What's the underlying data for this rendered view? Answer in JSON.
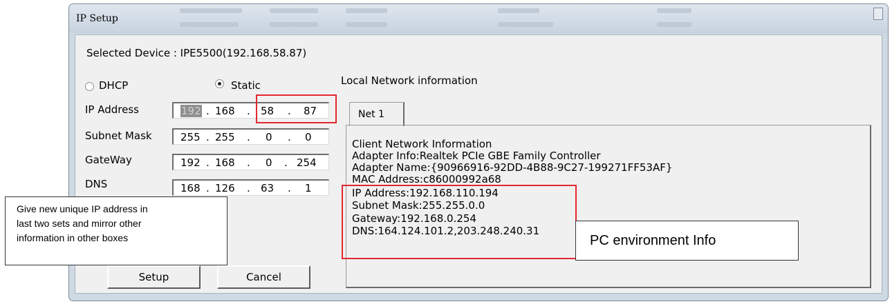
{
  "window": {
    "title": "IP Setup"
  },
  "selected_device": "Selected Device : IPE5500(192.168.58.87)",
  "mode": {
    "dhcp_label": "DHCP",
    "static_label": "Static",
    "selected": "Static"
  },
  "fields": {
    "ip_label": "IP Address",
    "subnet_label": "Subnet Mask",
    "gateway_label": "GateWay",
    "dns_label": "DNS",
    "ip": [
      "192",
      "168",
      "58",
      "87"
    ],
    "subnet": [
      "255",
      "255",
      "0",
      "0"
    ],
    "gateway": [
      "192",
      "168",
      "0",
      "254"
    ],
    "dns": [
      "168",
      "126",
      "63",
      "1"
    ]
  },
  "buttons": {
    "setup": "Setup",
    "cancel": "Cancel"
  },
  "local_network": {
    "heading": "Local Network information",
    "tab": "Net 1",
    "lines": [
      "Client Network Information",
      "Adapter Info:Realtek PCIe GBE Family Controller",
      "Adapter Name:{90966916-92DD-4B88-9C27-199271FF53AF}",
      "MAC Address:c86000992a68",
      "IP Address:192.168.110.194",
      "Subnet Mask:255.255.0.0",
      "Gateway:192.168.0.254",
      "DNS:164.124.101.2,203.248.240.31"
    ]
  },
  "annotations": {
    "left_note": [
      "Give new unique IP address in",
      "last two sets and mirror other",
      "information in other boxes"
    ],
    "right_note": "PC environment Info"
  },
  "colors": {
    "highlight": "#e3262e",
    "window_frame": "#cfd9e4",
    "client_bg": "#f0f0f0"
  }
}
